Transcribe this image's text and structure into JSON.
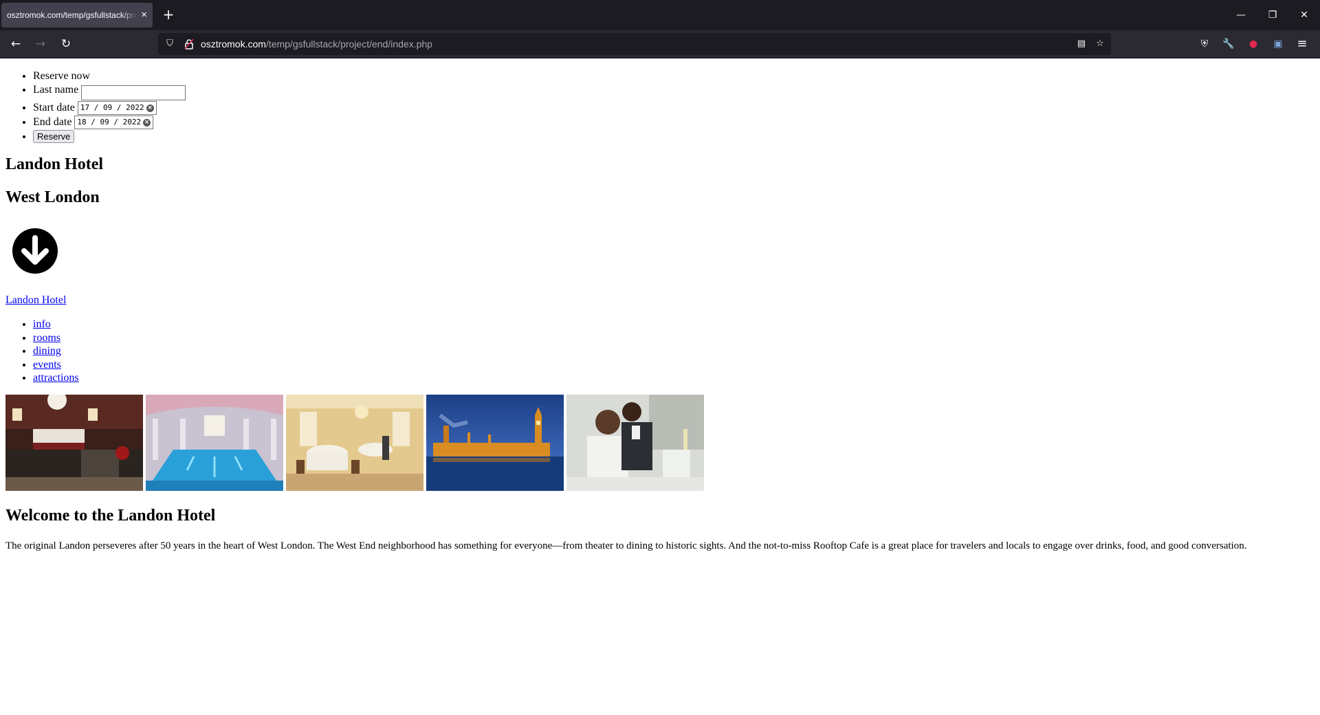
{
  "browser": {
    "tab_title": "osztromok.com/temp/gsfullstack/project/end/index.php",
    "url_domain": "osztromok.com",
    "url_path": "/temp/gsfullstack/project/end/index.php",
    "icons": {
      "back": "←",
      "forward": "→",
      "reload": "↻",
      "new_tab": "+",
      "close_tab": "×",
      "minimize": "—",
      "restore": "❐",
      "close": "✕",
      "shield": "⛉",
      "lock": "🔒",
      "reader": "▤",
      "bookmark": "☆",
      "pocket": "⛨",
      "tools": "🔧",
      "extension": "●",
      "container": "▣",
      "menu": "≡"
    }
  },
  "reserve": {
    "heading": "Reserve now",
    "last_name_label": "Last name",
    "last_name_value": "",
    "start_date_label": "Start date",
    "start_date_value": "17 / 09 / 2022",
    "end_date_label": "End date",
    "end_date_value": "18 / 09 / 2022",
    "button_label": "Reserve"
  },
  "header": {
    "hotel_name": "Landon Hotel",
    "area": "West London"
  },
  "home_link": "Landon Hotel",
  "nav": [
    "info",
    "rooms",
    "dining",
    "events",
    "attractions"
  ],
  "welcome": {
    "title": "Welcome to the Landon Hotel",
    "body": "The original Landon perseveres after 50 years in the heart of West London. The West End neighborhood has something for everyone—from theater to dining to historic sights. And the not-to-miss Rooftop Cafe is a great place for travelers and locals to engage over drinks, food, and good conversation."
  },
  "colors": {
    "link": "#0000ee",
    "tabbar_bg": "#1c1b22",
    "navbar_bg": "#2b2a33"
  }
}
